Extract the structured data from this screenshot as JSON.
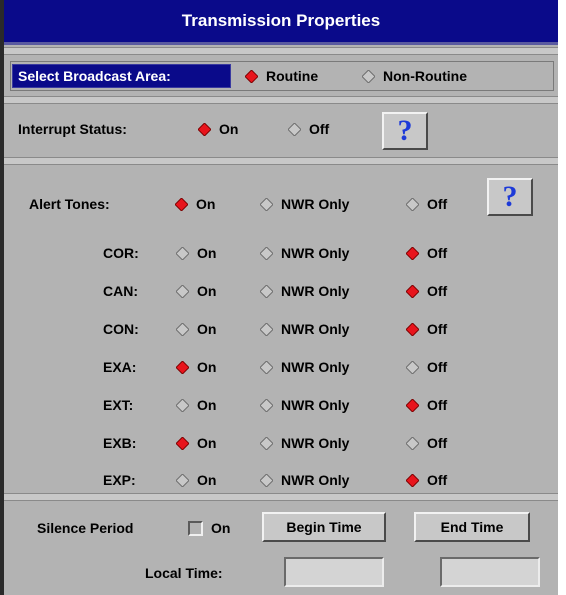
{
  "title": "Transmission Properties",
  "broadcast_area": {
    "label": "Select Broadcast Area:",
    "options": [
      "Routine",
      "Non-Routine"
    ],
    "selected": "Routine"
  },
  "interrupt_status": {
    "label": "Interrupt Status:",
    "options": [
      "On",
      "Off"
    ],
    "selected": "On",
    "help_label": "?"
  },
  "alert_tones": {
    "label": "Alert Tones:",
    "options": [
      "On",
      "NWR Only",
      "Off"
    ],
    "selected": "On",
    "help_label": "?"
  },
  "event_codes": [
    {
      "code": "COR:",
      "selected": "Off"
    },
    {
      "code": "CAN:",
      "selected": "Off"
    },
    {
      "code": "CON:",
      "selected": "Off"
    },
    {
      "code": "EXA:",
      "selected": "On"
    },
    {
      "code": "EXT:",
      "selected": "Off"
    },
    {
      "code": "EXB:",
      "selected": "On"
    },
    {
      "code": "EXP:",
      "selected": "Off"
    }
  ],
  "code_options": [
    "On",
    "NWR Only",
    "Off"
  ],
  "silence": {
    "label": "Silence Period",
    "checkbox_label": "On",
    "checked": false,
    "begin_label": "Begin Time",
    "end_label": "End Time",
    "local_time_label": "Local Time:",
    "begin_value": "",
    "end_value": ""
  },
  "colors": {
    "selected_diamond": "#e8141c",
    "unselected_diamond": "#c8c8c8",
    "title_bg": "#0a0a8a"
  }
}
